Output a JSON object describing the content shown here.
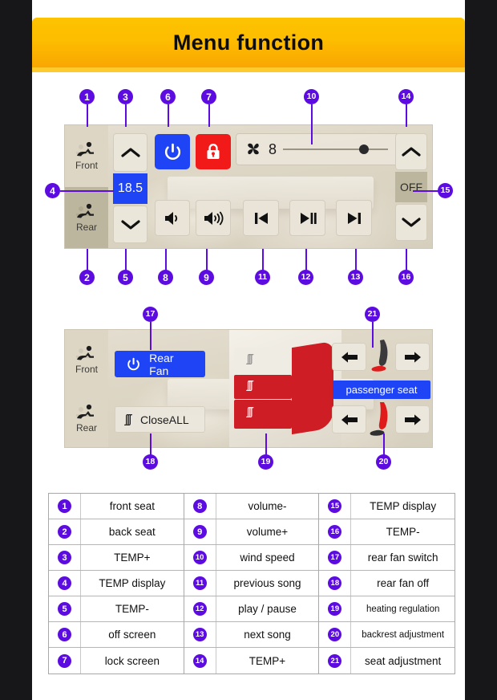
{
  "header": {
    "title": "Menu function"
  },
  "main_panel": {
    "tabs": [
      {
        "label": "Front",
        "icon": "seat-icon",
        "active": true
      },
      {
        "label": "Rear",
        "icon": "seat-icon",
        "active": false
      }
    ],
    "temp_up_icon": "chevron-up-icon",
    "temp_down_icon": "chevron-down-icon",
    "temp_value": "18.5",
    "power_icon": "power-icon",
    "lock_icon": "lock-icon",
    "fan": {
      "icon": "fan-icon",
      "value": "8",
      "slider_position_pct": 78
    },
    "volume_down_icon": "volume-low-icon",
    "volume_up_icon": "volume-high-icon",
    "prev_icon": "previous-track-icon",
    "play_icon": "play-pause-icon",
    "next_icon": "next-track-icon",
    "right_up_icon": "chevron-up-icon",
    "right_down_icon": "chevron-down-icon",
    "right_status": "OFF"
  },
  "rear_panel": {
    "tabs": [
      {
        "label": "Front",
        "icon": "seat-icon",
        "active": true
      },
      {
        "label": "Rear",
        "icon": "seat-icon",
        "active": false
      }
    ],
    "rear_fan_label": "Rear  Fan",
    "rear_fan_icon": "power-icon",
    "close_all_label": "CloseALL",
    "close_all_icon": "heat-wave-icon",
    "seat_tag_label": "passenger seat",
    "arrow_left_icon": "arrow-left-icon",
    "arrow_right_icon": "arrow-right-icon",
    "heat_glyph": "ʃʃʃ"
  },
  "callouts": {
    "n1": "1",
    "n2": "2",
    "n3": "3",
    "n4": "4",
    "n5": "5",
    "n6": "6",
    "n7": "7",
    "n8": "8",
    "n9": "9",
    "n10": "10",
    "n11": "11",
    "n12": "12",
    "n13": "13",
    "n14": "14",
    "n15": "15",
    "n16": "16",
    "n17": "17",
    "n18": "18",
    "n19": "19",
    "n20": "20",
    "n21": "21"
  },
  "legend": {
    "columns": [
      [
        {
          "num": "1",
          "label": "front seat"
        },
        {
          "num": "2",
          "label": "back seat"
        },
        {
          "num": "3",
          "label": "TEMP+"
        },
        {
          "num": "4",
          "label": "TEMP display"
        },
        {
          "num": "5",
          "label": "TEMP-"
        },
        {
          "num": "6",
          "label": "off screen"
        },
        {
          "num": "7",
          "label": "lock screen"
        }
      ],
      [
        {
          "num": "8",
          "label": "volume-"
        },
        {
          "num": "9",
          "label": "volume+"
        },
        {
          "num": "10",
          "label": "wind speed"
        },
        {
          "num": "11",
          "label": "previous song"
        },
        {
          "num": "12",
          "label": "play / pause"
        },
        {
          "num": "13",
          "label": "next song"
        },
        {
          "num": "14",
          "label": "TEMP+"
        }
      ],
      [
        {
          "num": "15",
          "label": "TEMP display"
        },
        {
          "num": "16",
          "label": "TEMP-"
        },
        {
          "num": "17",
          "label": "rear fan switch"
        },
        {
          "num": "18",
          "label": "rear fan off"
        },
        {
          "num": "19",
          "label": "heating regulation"
        },
        {
          "num": "20",
          "label": "backrest adjustment"
        },
        {
          "num": "21",
          "label": "seat adjustment"
        }
      ]
    ]
  },
  "colors": {
    "banner": "#fdbd00",
    "accent_blue": "#1f44f5",
    "accent_red": "#f21919",
    "callout_purple": "#5c0ce0",
    "panel_bg": "#ddd6c5"
  }
}
